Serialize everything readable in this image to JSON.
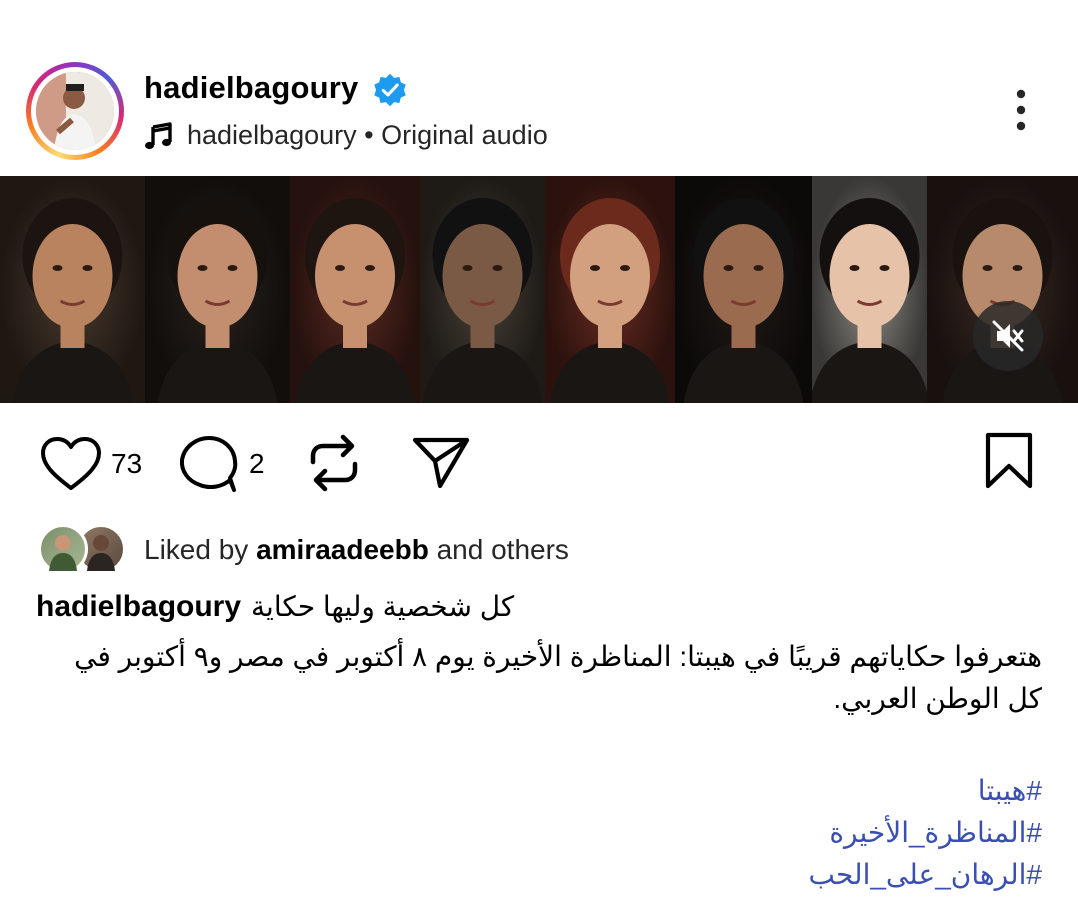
{
  "post": {
    "username": "hadielbagoury",
    "audio": {
      "artist": "hadielbagoury",
      "separator": " • ",
      "track": "Original audio"
    }
  },
  "media": {
    "panels": [
      {
        "bg": "#4a3a2e",
        "skin": "#b9835f",
        "hair": "#1c1410"
      },
      {
        "bg": "#2a221d",
        "skin": "#c28e6f",
        "hair": "#17110d"
      },
      {
        "bg": "#5c2a22",
        "skin": "#c79170",
        "hair": "#1e1410"
      },
      {
        "bg": "#4a4138",
        "skin": "#7b5a45",
        "hair": "#111"
      },
      {
        "bg": "#6b2c22",
        "skin": "#d3a07f",
        "hair": "#6b2a1c"
      },
      {
        "bg": "#1f1a17",
        "skin": "#9b6b4f",
        "hair": "#111"
      },
      {
        "bg": "#8f8c86",
        "skin": "#e6c2a8",
        "hair": "#141010"
      },
      {
        "bg": "#3b2a24",
        "skin": "#b88a6c",
        "hair": "#1a120f"
      }
    ],
    "muted": true
  },
  "actions": {
    "likes": "73",
    "comments": "2"
  },
  "liked_by": {
    "prefix": "Liked by ",
    "user": "amiraadeebb",
    "suffix": " and others"
  },
  "caption": {
    "username": "hadielbagoury",
    "first_line": "كل شخصية وليها حكاية",
    "body": "هتعرفوا حكاياتهم قريبًا في هيبتا: المناظرة الأخيرة يوم ٨ أكتوبر في مصر و٩ أكتوبر في كل الوطن العربي.",
    "hashtags": [
      "#هيبتا",
      "#المناظرة_الأخيرة",
      "#الرهان_على_الحب"
    ]
  },
  "colors": {
    "verified": "#1d9bf0",
    "hashtag": "#3b4fb3"
  }
}
